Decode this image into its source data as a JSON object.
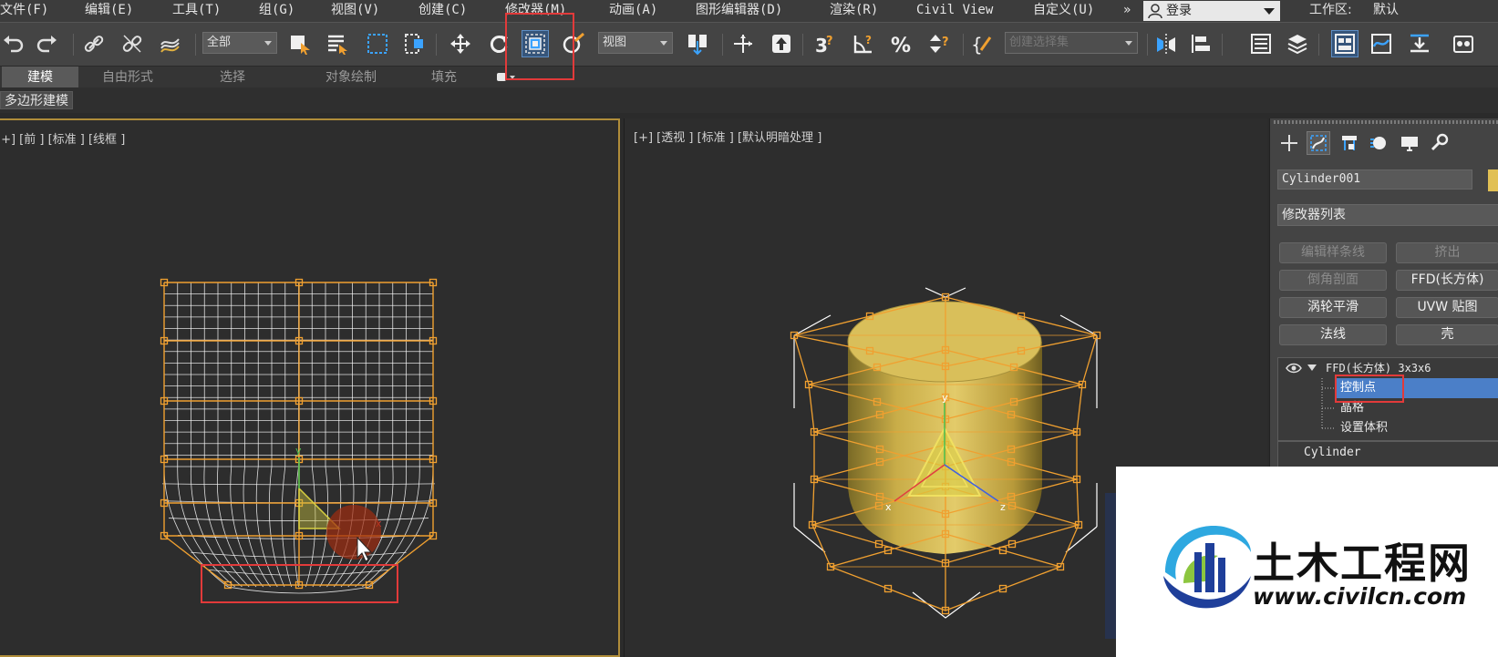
{
  "menubar": {
    "items": [
      "文件(F)",
      "编辑(E)",
      "工具(T)",
      "组(G)",
      "视图(V)",
      "创建(C)",
      "修改器(M)",
      "动画(A)",
      "图形编辑器(D)",
      "渲染(R)",
      "Civil View",
      "自定义(U)"
    ],
    "more": "»",
    "login": "登录",
    "workspace_label": "工作区:",
    "workspace_value": "默认"
  },
  "toolbar": {
    "selection_filter": "全部",
    "ref_coord": "视图",
    "named_selection": "创建选择集"
  },
  "ribbon": {
    "tabs": [
      "建模",
      "自由形式",
      "选择",
      "对象绘制",
      "填充"
    ],
    "active_tab": "建模",
    "sub_label": "多边形建模"
  },
  "viewport_left": {
    "label": "[+] [前 ] [标准 ] [线框 ]"
  },
  "viewport_right": {
    "label": "[+] [透视 ] [标准 ] [默认明暗处理 ]"
  },
  "command_panel": {
    "object_name": "Cylinder001",
    "object_color": "#e1c054",
    "modifier_list": "修改器列表",
    "buttons": [
      {
        "label": "编辑样条线",
        "enabled": false
      },
      {
        "label": "挤出",
        "enabled": false
      },
      {
        "label": "倒角剖面",
        "enabled": false
      },
      {
        "label": "FFD(长方体)",
        "enabled": true
      },
      {
        "label": "涡轮平滑",
        "enabled": true
      },
      {
        "label": "UVW 贴图",
        "enabled": true
      },
      {
        "label": "法线",
        "enabled": true
      },
      {
        "label": "壳",
        "enabled": true
      }
    ],
    "stack": {
      "modifier": "FFD(长方体) 3x3x6",
      "sub_items": [
        "控制点",
        "晶格",
        "设置体积"
      ],
      "selected_sub": "控制点",
      "base": "Cylinder"
    }
  },
  "watermark": {
    "title": "土木工程网",
    "url": "www.civilcn.com"
  },
  "colors": {
    "accent_orange": "#f0a030",
    "highlight_blue": "#4b7fc8",
    "annotation_red": "#e23a3a",
    "cylinder_yellow": "#d9bf5a"
  }
}
